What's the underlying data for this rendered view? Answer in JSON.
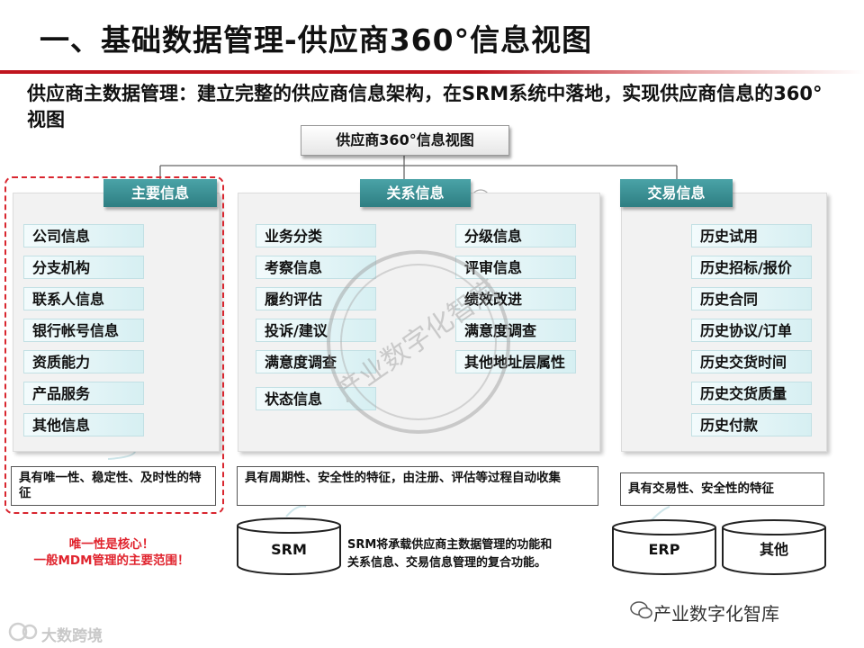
{
  "title": "一、基础数据管理-供应商360°信息视图",
  "subtitle": "供应商主数据管理：建立完整的供应商信息架构，在SRM系统中落地，实现供应商信息的360°视图",
  "root": "供应商360°信息视图",
  "groups": [
    {
      "header": "主要信息",
      "items": [
        "公司信息",
        "分支机构",
        "联系人信息",
        "银行帐号信息",
        "资质能力",
        "产品服务",
        "其他信息"
      ],
      "feature": "具有唯一性、稳定性、及时性的特征"
    },
    {
      "header": "关系信息",
      "items_left": [
        "业务分类",
        "考察信息",
        "履约评估",
        "投诉/建议",
        "满意度调查",
        "状态信息"
      ],
      "items_right": [
        "分级信息",
        "评审信息",
        "绩效改进",
        "满意度调查",
        "其他地址层属性"
      ],
      "feature": "具有周期性、安全性的特征，由注册、评估等过程自动收集"
    },
    {
      "header": "交易信息",
      "items": [
        "历史试用",
        "历史招标/报价",
        "历史合同",
        "历史协议/订单",
        "历史交货时间",
        "历史交货质量",
        "历史付款"
      ],
      "feature": "具有交易性、安全性的特征"
    }
  ],
  "note": {
    "line1": "唯一性是核心！",
    "line2": "一般MDM管理的主要范围！"
  },
  "systems": {
    "srm": "SRM",
    "srm_desc_line1": "SRM将承载供应商主数据管理的功能和",
    "srm_desc_line2": "关系信息、交易信息管理的复合功能。",
    "erp": "ERP",
    "other": "其他"
  },
  "watermark": {
    "stamp": "产业数字化智库",
    "caption": "产业数字化智库",
    "logo": "大数跨境"
  },
  "colors": {
    "header_teal": "#3a9296",
    "accent_red": "#c0141e",
    "item_fill": "#d6eff2"
  }
}
